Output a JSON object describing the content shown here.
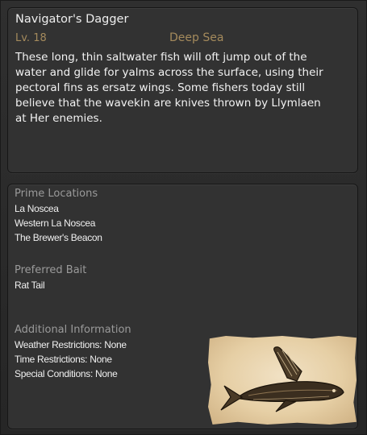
{
  "item": {
    "name": "Navigator's Dagger",
    "level": "Lv. 18",
    "area": "Deep Sea",
    "description": "These long, thin saltwater fish will oft jump out of the water and glide for yalms across the surface, using their pectoral fins as ersatz wings. Some fishers today still believe that the wavekin are knives thrown by Llymlaen at Her enemies."
  },
  "prime_locations": {
    "heading": "Prime Locations",
    "items": [
      "La Noscea",
      "Western La Noscea",
      "The Brewer's Beacon"
    ]
  },
  "preferred_bait": {
    "heading": "Preferred Bait",
    "items": [
      "Rat Tail"
    ]
  },
  "additional_info": {
    "heading": "Additional Information",
    "items": [
      "Weather Restrictions: None",
      "Time Restrictions: None",
      "Special Conditions: None"
    ]
  },
  "fish_image": {
    "icon": "flying-fish-sketch"
  }
}
